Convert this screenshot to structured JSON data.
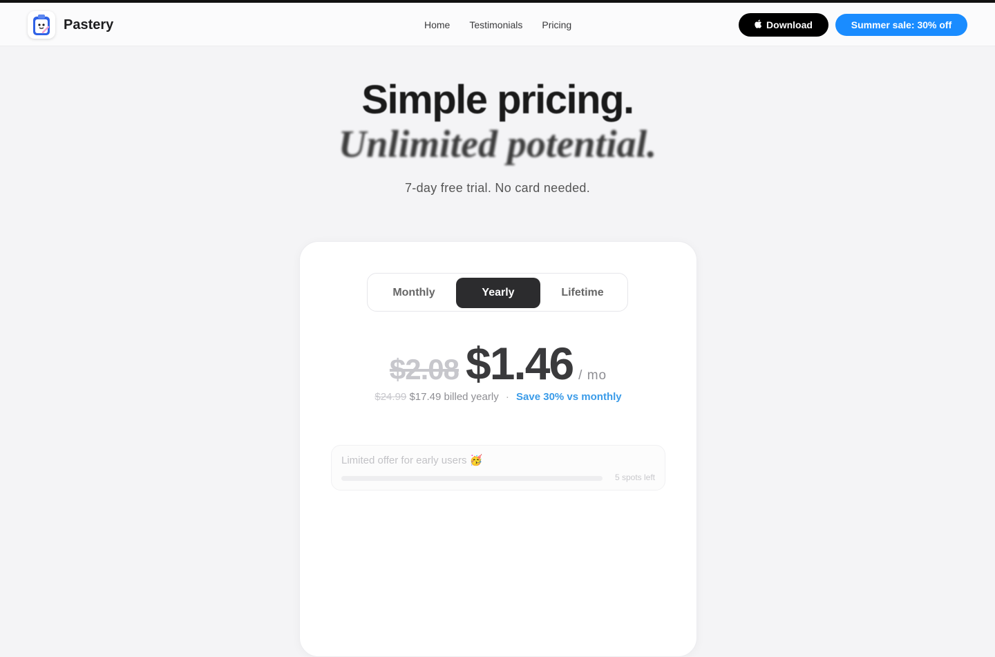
{
  "header": {
    "brand": "Pastery",
    "nav": [
      "Home",
      "Testimonials",
      "Pricing"
    ],
    "download_label": "Download",
    "sale_label": "Summer sale: 30% off"
  },
  "hero": {
    "title": "Simple pricing.",
    "subtitle": "Unlimited potential.",
    "note": "7-day free trial. No card needed."
  },
  "pricing": {
    "tabs": [
      "Monthly",
      "Yearly",
      "Lifetime"
    ],
    "selected_tab": "Yearly",
    "old_price": "$2.08",
    "price": "$1.46",
    "unit": "/ mo",
    "billing_old": "$24.99",
    "billing_current": "$17.49 billed yearly",
    "billing_sep": "·",
    "billing_save": "Save 30% vs monthly"
  },
  "offer": {
    "title": "Limited offer for early users 🥳",
    "spots": "5 spots left",
    "progress": 0
  },
  "colors": {
    "accent": "#1a8cff",
    "save_text": "#3a9be8",
    "selected_tab": "#2c2c2e"
  },
  "icons": {
    "logo": "clipboard-app-icon",
    "download": "apple-icon"
  }
}
